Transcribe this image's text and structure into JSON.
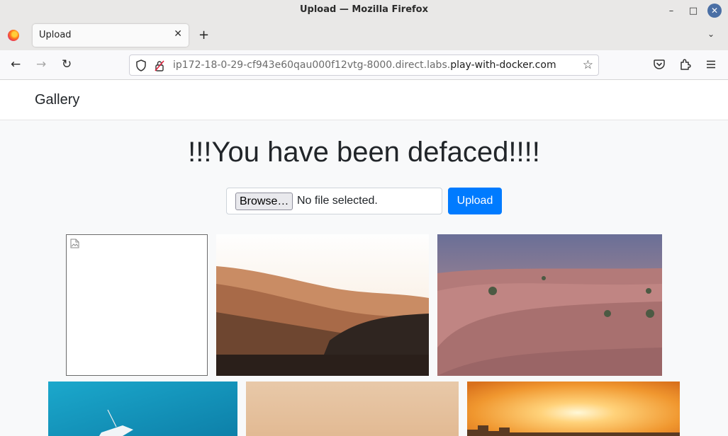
{
  "window": {
    "title": "Upload — Mozilla Firefox",
    "controls": {
      "minimize": "–",
      "maximize": "□",
      "close": "✕"
    }
  },
  "tabs": [
    {
      "label": "Upload",
      "active": true
    }
  ],
  "tab_controls": {
    "new_tab": "+",
    "list_all": "⌄"
  },
  "navigation": {
    "back": "←",
    "forward": "→",
    "reload": "↻",
    "url_prefix": "ip172-18-0-29-cf943e60qau000f12vtg-8000.direct.labs.",
    "url_domain": "play-with-docker.com",
    "bookmark": "☆"
  },
  "site": {
    "brand": "Gallery",
    "heading": "!!!You have been defaced!!!!",
    "upload_form": {
      "browse_label": "Browse…",
      "file_status": "No file selected.",
      "submit_label": "Upload"
    }
  },
  "colors": {
    "primary": "#007bff",
    "page_bg": "#f8f9fa",
    "chrome_bg": "#e9e8e7",
    "text": "#212529"
  },
  "icons": [
    "firefox-logo-icon",
    "shield-icon",
    "insecure-lock-icon",
    "star-icon",
    "pocket-icon",
    "extensions-icon",
    "menu-icon",
    "broken-image-icon"
  ]
}
